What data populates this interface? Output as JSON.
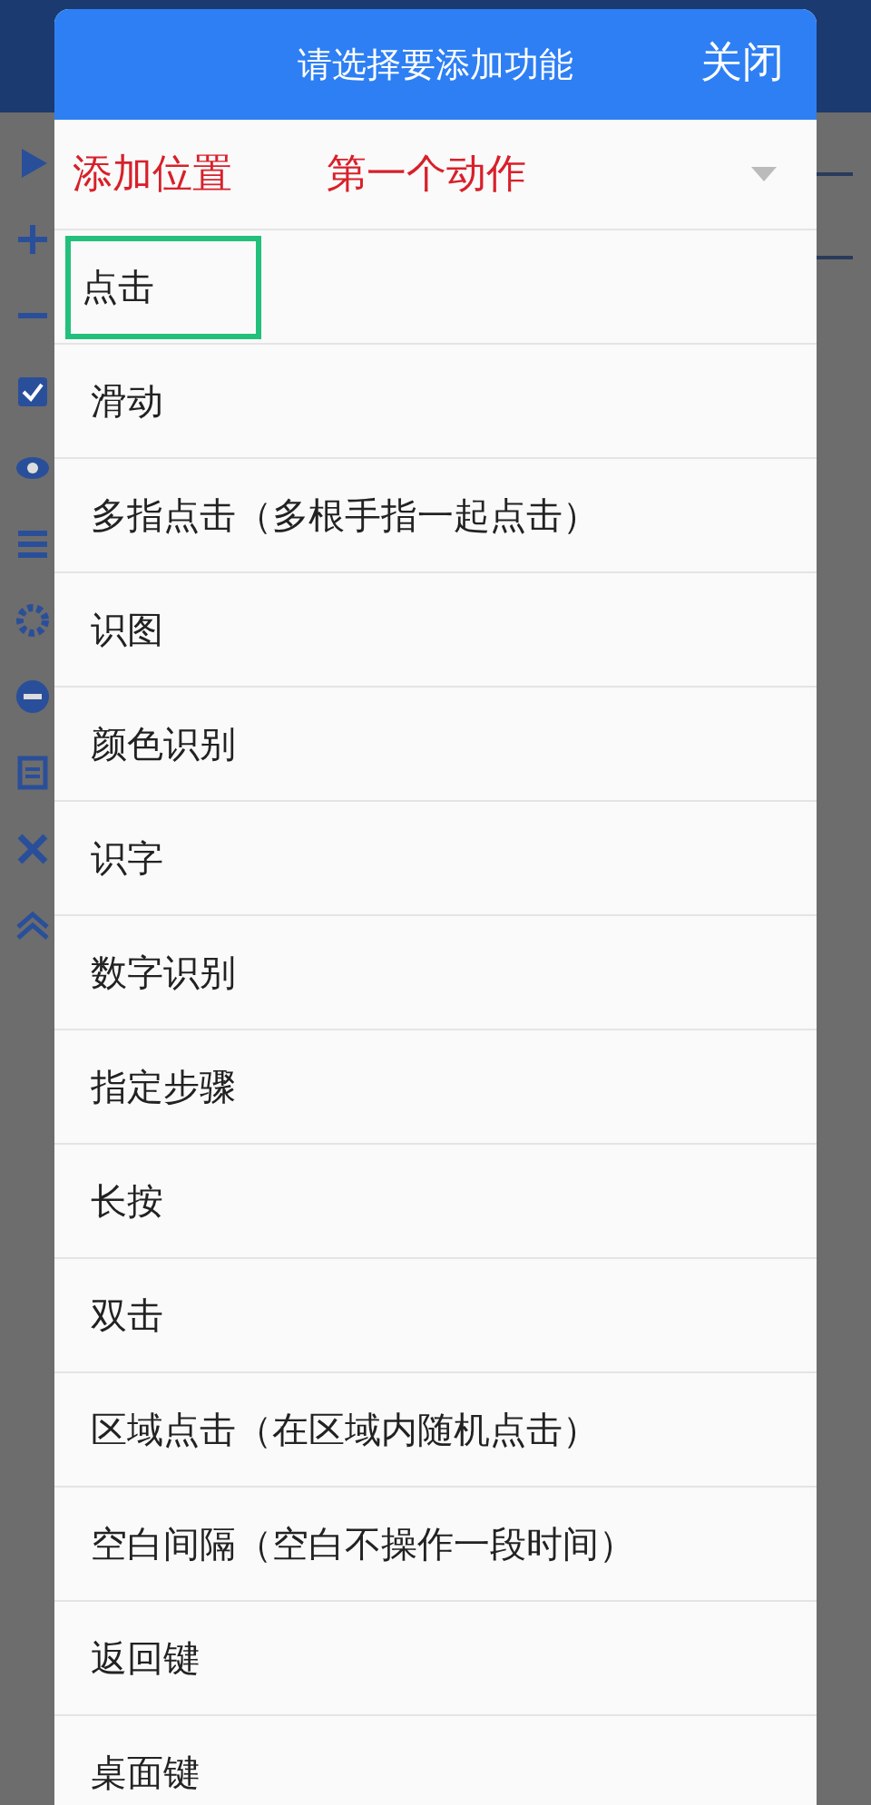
{
  "dialog": {
    "title": "请选择要添加功能",
    "close": "关闭",
    "position": {
      "label": "添加位置",
      "value": "第一个动作"
    },
    "items": [
      {
        "label": "点击",
        "selected": true
      },
      {
        "label": "滑动",
        "selected": false
      },
      {
        "label": "多指点击（多根手指一起点击）",
        "selected": false
      },
      {
        "label": "识图",
        "selected": false
      },
      {
        "label": "颜色识别",
        "selected": false
      },
      {
        "label": "识字",
        "selected": false
      },
      {
        "label": "数字识别",
        "selected": false
      },
      {
        "label": "指定步骤",
        "selected": false
      },
      {
        "label": "长按",
        "selected": false
      },
      {
        "label": "双击",
        "selected": false
      },
      {
        "label": "区域点击（在区域内随机点击）",
        "selected": false
      },
      {
        "label": "空白间隔（空白不操作一段时间）",
        "selected": false
      },
      {
        "label": "返回键",
        "selected": false
      },
      {
        "label": "桌面键",
        "selected": false
      }
    ]
  }
}
